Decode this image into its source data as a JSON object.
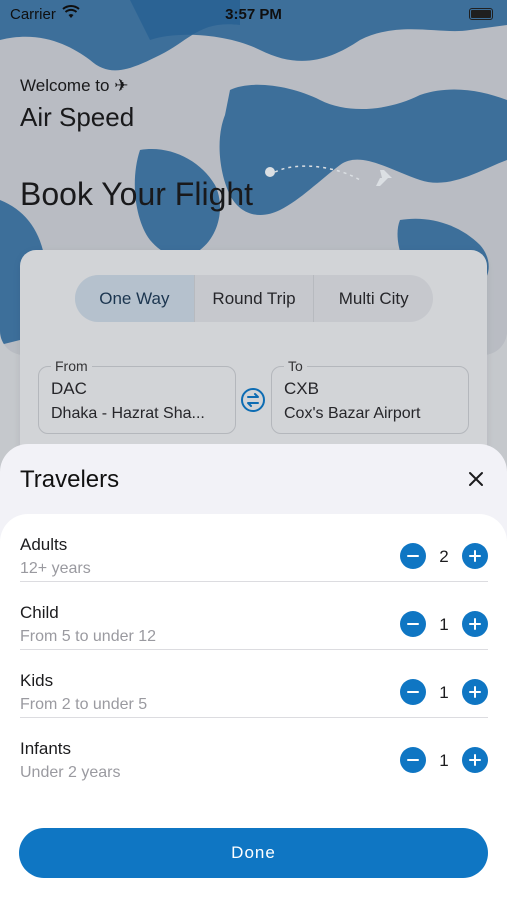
{
  "status_bar": {
    "carrier": "Carrier",
    "time": "3:57 PM"
  },
  "header": {
    "welcome": "Welcome to ✈",
    "app_name": "Air Speed",
    "title": "Book Your Flight"
  },
  "search": {
    "trip_types": [
      {
        "label": "One Way",
        "active": true
      },
      {
        "label": "Round Trip",
        "active": false
      },
      {
        "label": "Multi City",
        "active": false
      }
    ],
    "from": {
      "label": "From",
      "code": "DAC",
      "name": "Dhaka - Hazrat Sha..."
    },
    "to": {
      "label": "To",
      "code": "CXB",
      "name": "Cox's Bazar Airport"
    }
  },
  "sheet": {
    "title": "Travelers",
    "travelers": [
      {
        "title": "Adults",
        "subtitle": "12+ years",
        "count": "2"
      },
      {
        "title": "Child",
        "subtitle": "From 5 to under 12",
        "count": "1"
      },
      {
        "title": "Kids",
        "subtitle": "From 2 to under 5",
        "count": "1"
      },
      {
        "title": "Infants",
        "subtitle": "Under 2 years",
        "count": "1"
      }
    ],
    "done_label": "Done"
  },
  "colors": {
    "accent": "#0f76c3",
    "map_land": "#0a64a8"
  },
  "icons": [
    "wifi-icon",
    "battery-icon",
    "plane-icon",
    "swap-icon",
    "close-icon",
    "minus-icon",
    "plus-icon"
  ]
}
